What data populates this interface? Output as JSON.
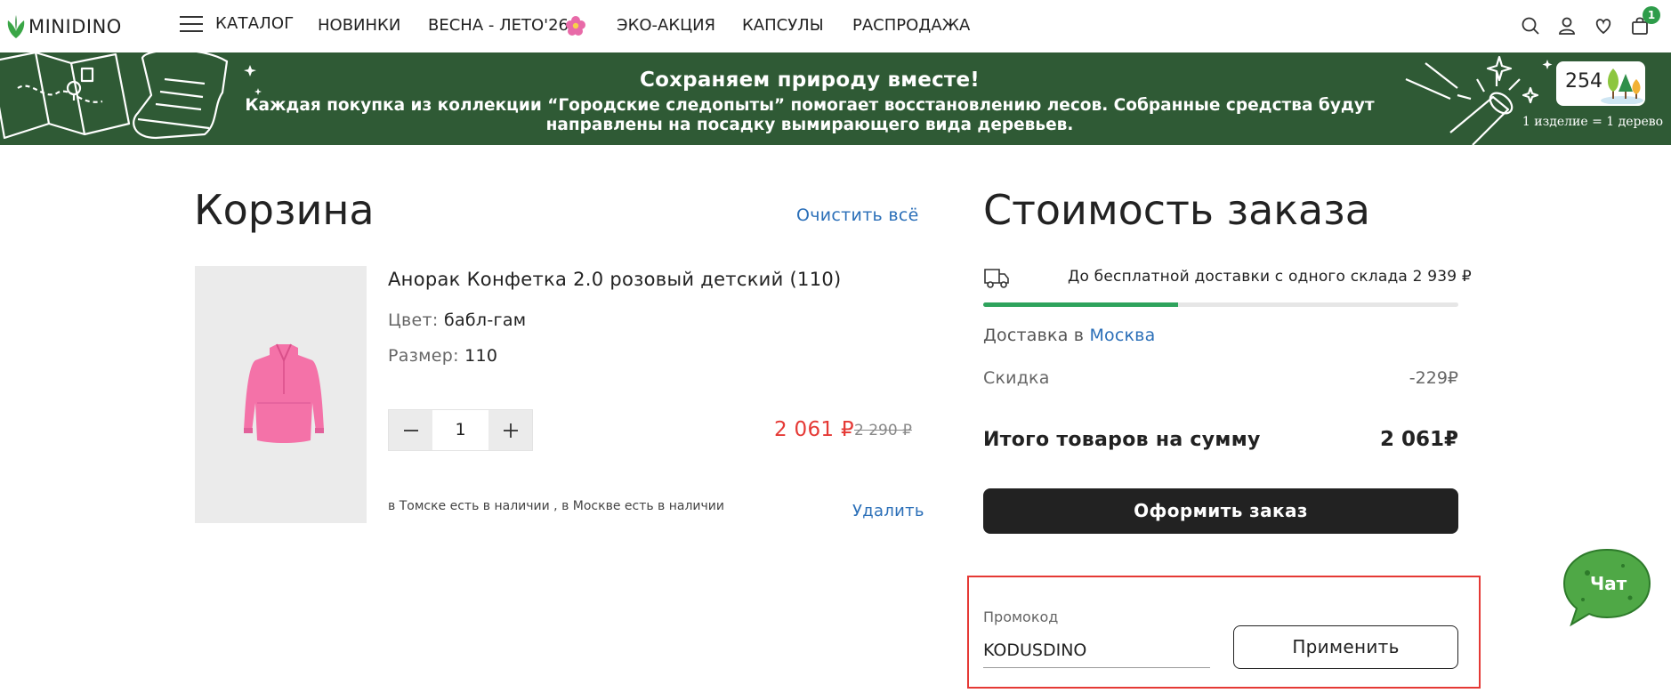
{
  "header": {
    "logo_text": "MINIDINO",
    "menu_label": "КАТАЛОГ",
    "nav": [
      "НОВИНКИ",
      "ВЕСНА - ЛЕТО'26",
      "ЭКО-АКЦИЯ",
      "КАПСУЛЫ",
      "РАСПРОДАЖА"
    ],
    "cart_count": "1",
    "icons": [
      "search-icon",
      "account-icon",
      "heart-icon",
      "bag-icon"
    ]
  },
  "banner": {
    "title": "Сохраняем природу вместе!",
    "text": "Каждая покупка из коллекции “Городские следопыты” помогает восстановлению лесов. Собранные средства будут направлены на посадку вымирающего вида деревьев.",
    "tree_count": "254",
    "tree_caption": "1 изделие = 1 дерево"
  },
  "cart": {
    "title": "Корзина",
    "clear_all": "Очистить всё",
    "item": {
      "name": "Анорак Конфетка 2.0 розовый детский (110)",
      "color_label": "Цвет:",
      "color_value": "бабл-гам",
      "size_label": "Размер:",
      "size_value": "110",
      "quantity": "1",
      "price": "2 061 ₽",
      "old_price": "2 290 ₽",
      "availability": "в Томске есть в наличии , в Москве есть в наличии",
      "remove": "Удалить"
    }
  },
  "summary": {
    "title": "Стоимость заказа",
    "free_shipping": "До бесплатной доставки с одного склада 2 939 ₽",
    "free_shipping_progress": 0.41,
    "delivery_prefix": "Доставка в",
    "delivery_city": "Москва",
    "discount_label": "Скидка",
    "discount_value": "-229₽",
    "total_label": "Итого товаров на сумму",
    "total_value": "2 061₽",
    "checkout": "Оформить заказ"
  },
  "promo": {
    "label": "Промокод",
    "value": "KODUSDINO",
    "apply": "Применить"
  },
  "chat": {
    "label": "Чат"
  },
  "colors": {
    "banner_bg": "#2f5a35",
    "accent_link": "#2b6fb8",
    "price_red": "#e53935",
    "brand_green": "#2e9c4a",
    "button_dark": "#222222"
  }
}
